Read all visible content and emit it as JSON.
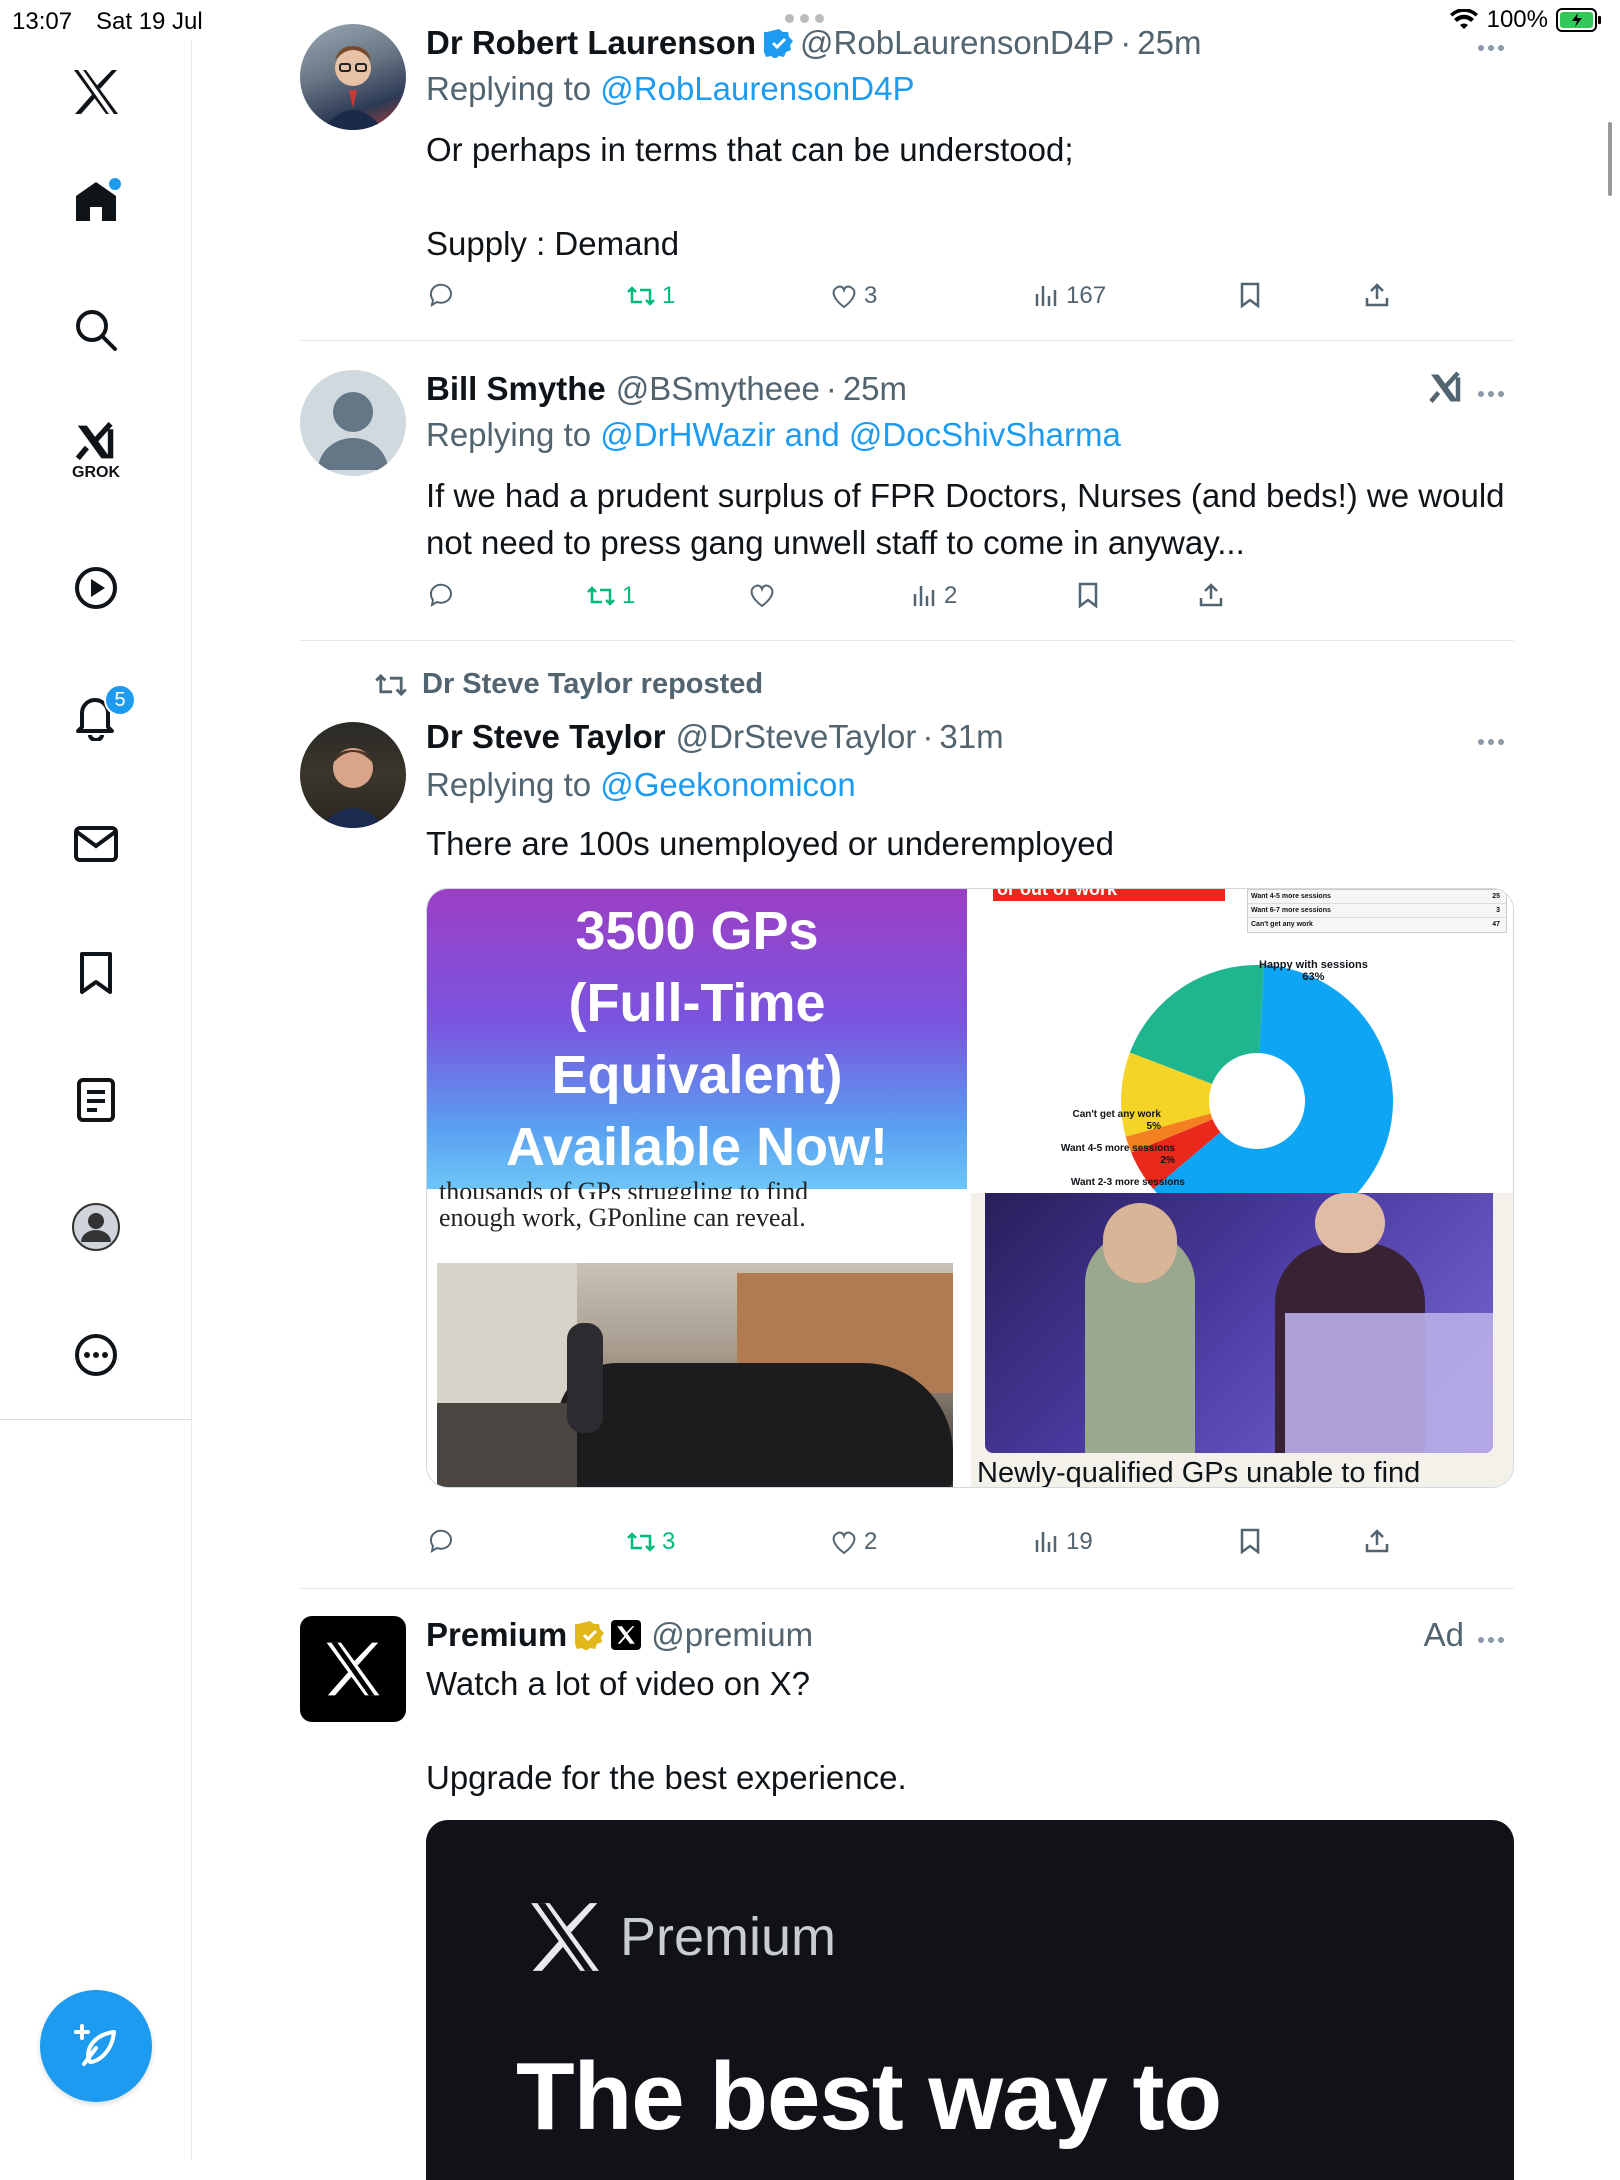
{
  "status_bar": {
    "time": "13:07",
    "date": "Sat 19 Jul",
    "battery": "100%"
  },
  "sidebar": {
    "grok_label": "GROK",
    "notifications_badge": "5",
    "items": [
      "x-logo",
      "home",
      "search",
      "grok",
      "videos",
      "notifications",
      "messages",
      "bookmarks",
      "lists",
      "profile",
      "more"
    ]
  },
  "tweets": [
    {
      "name": "Dr Robert Laurenson",
      "verified": true,
      "handle": "@RobLaurensonD4P",
      "time": "25m",
      "replying_prefix": "Replying to ",
      "replying_to": "@RobLaurensonD4P",
      "text": "Or perhaps in terms that can be understood;\n\nSupply : Demand",
      "reposts": "1",
      "likes": "3",
      "views": "167"
    },
    {
      "name": "Bill Smythe",
      "handle": "@BSmytheee",
      "time": "25m",
      "replying_prefix": "Replying to ",
      "replying_to": "@DrHWazir and @DocShivSharma",
      "text": "If we had a prudent surplus of FPR Doctors, Nurses (and beds!) we would not need to press gang unwell staff to come in anyway...",
      "reposts": "1",
      "likes": "",
      "views": "2"
    },
    {
      "reposted_by": "Dr Steve Taylor reposted",
      "name": "Dr Steve Taylor",
      "handle": "@DrSteveTaylor",
      "time": "31m",
      "replying_prefix": "Replying to ",
      "replying_to": "@Geekonomicon",
      "text": "There are 100s unemployed or  underemployed",
      "media": {
        "img1_lines": [
          "3500 GPs",
          "(Full-Time",
          "Equivalent)",
          "Available Now!"
        ],
        "img2_header": "or out of work",
        "img2_table": [
          {
            "label": "Want 4-5 more sessions",
            "value": "25"
          },
          {
            "label": "Want 6-7 more sessions",
            "value": "3"
          },
          {
            "label": "Can't get any work",
            "value": "47"
          }
        ],
        "img2_chart": {
          "type": "pie",
          "slices": [
            {
              "label": "Happy with sessions",
              "pct_label": "63%",
              "value": 63,
              "color": "#0ea5f5"
            },
            {
              "label": "Can't get any work",
              "pct_label": "5%",
              "value": 5,
              "color": "#e8291c"
            },
            {
              "label": "Want 4-5 more sessions",
              "pct_label": "2%",
              "value": 2,
              "color": "#f5801f"
            },
            {
              "label": "Want 2-3 more sessions",
              "pct_label": "",
              "value": 10,
              "color": "#f5d327"
            },
            {
              "label": "",
              "pct_label": "",
              "value": 20,
              "color": "#1fb58f"
            }
          ]
        },
        "img3_text_top": "thousands of GPs struggling to find",
        "img3_text": "enough work, GPonline can reveal.",
        "img4_caption": "Newly-qualified GPs unable to find"
      },
      "reposts": "3",
      "likes": "2",
      "views": "19"
    },
    {
      "name": "Premium",
      "handle": "@premium",
      "ad_label": "Ad",
      "text": "Watch a lot of video on X?\n\nUpgrade for the best experience.",
      "card_brand": "Premium",
      "card_headline": "The best way to"
    }
  ]
}
